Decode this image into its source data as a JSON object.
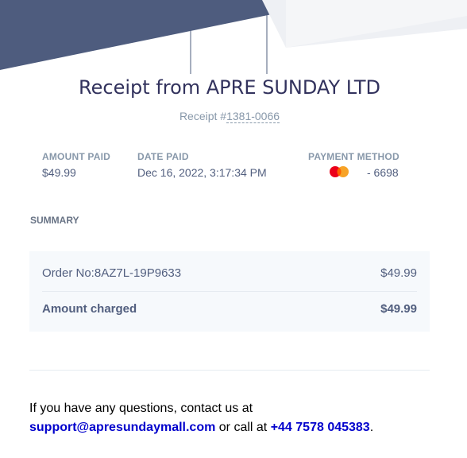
{
  "header": {
    "title": "Receipt from APRE SUNDAY LTD",
    "receipt_prefix": "Receipt #",
    "receipt_number": "1381-0066"
  },
  "details": {
    "amount_paid_label": "AMOUNT PAID",
    "amount_paid_value": "$49.99",
    "date_paid_label": "DATE PAID",
    "date_paid_value": "Dec 16, 2022, 3:17:34 PM",
    "payment_method_label": "PAYMENT METHOD",
    "card_brand_icon": "mastercard-icon",
    "card_last4": "- 6698"
  },
  "summary": {
    "label": "SUMMARY",
    "item_label": "Order No:8AZ7L-19P9633",
    "item_amount": "$49.99",
    "total_label": "Amount charged",
    "total_amount": "$49.99"
  },
  "contact": {
    "line1": "If you have any questions, contact us at",
    "email": "support@apresundaymall.com",
    "middle": " or call at ",
    "phone": "+44 7578 045383",
    "end": "."
  },
  "colors": {
    "banner": "#525f7f",
    "mastercard_red": "#eb001b",
    "mastercard_orange": "#f79e1b",
    "link": "#0000cc"
  }
}
